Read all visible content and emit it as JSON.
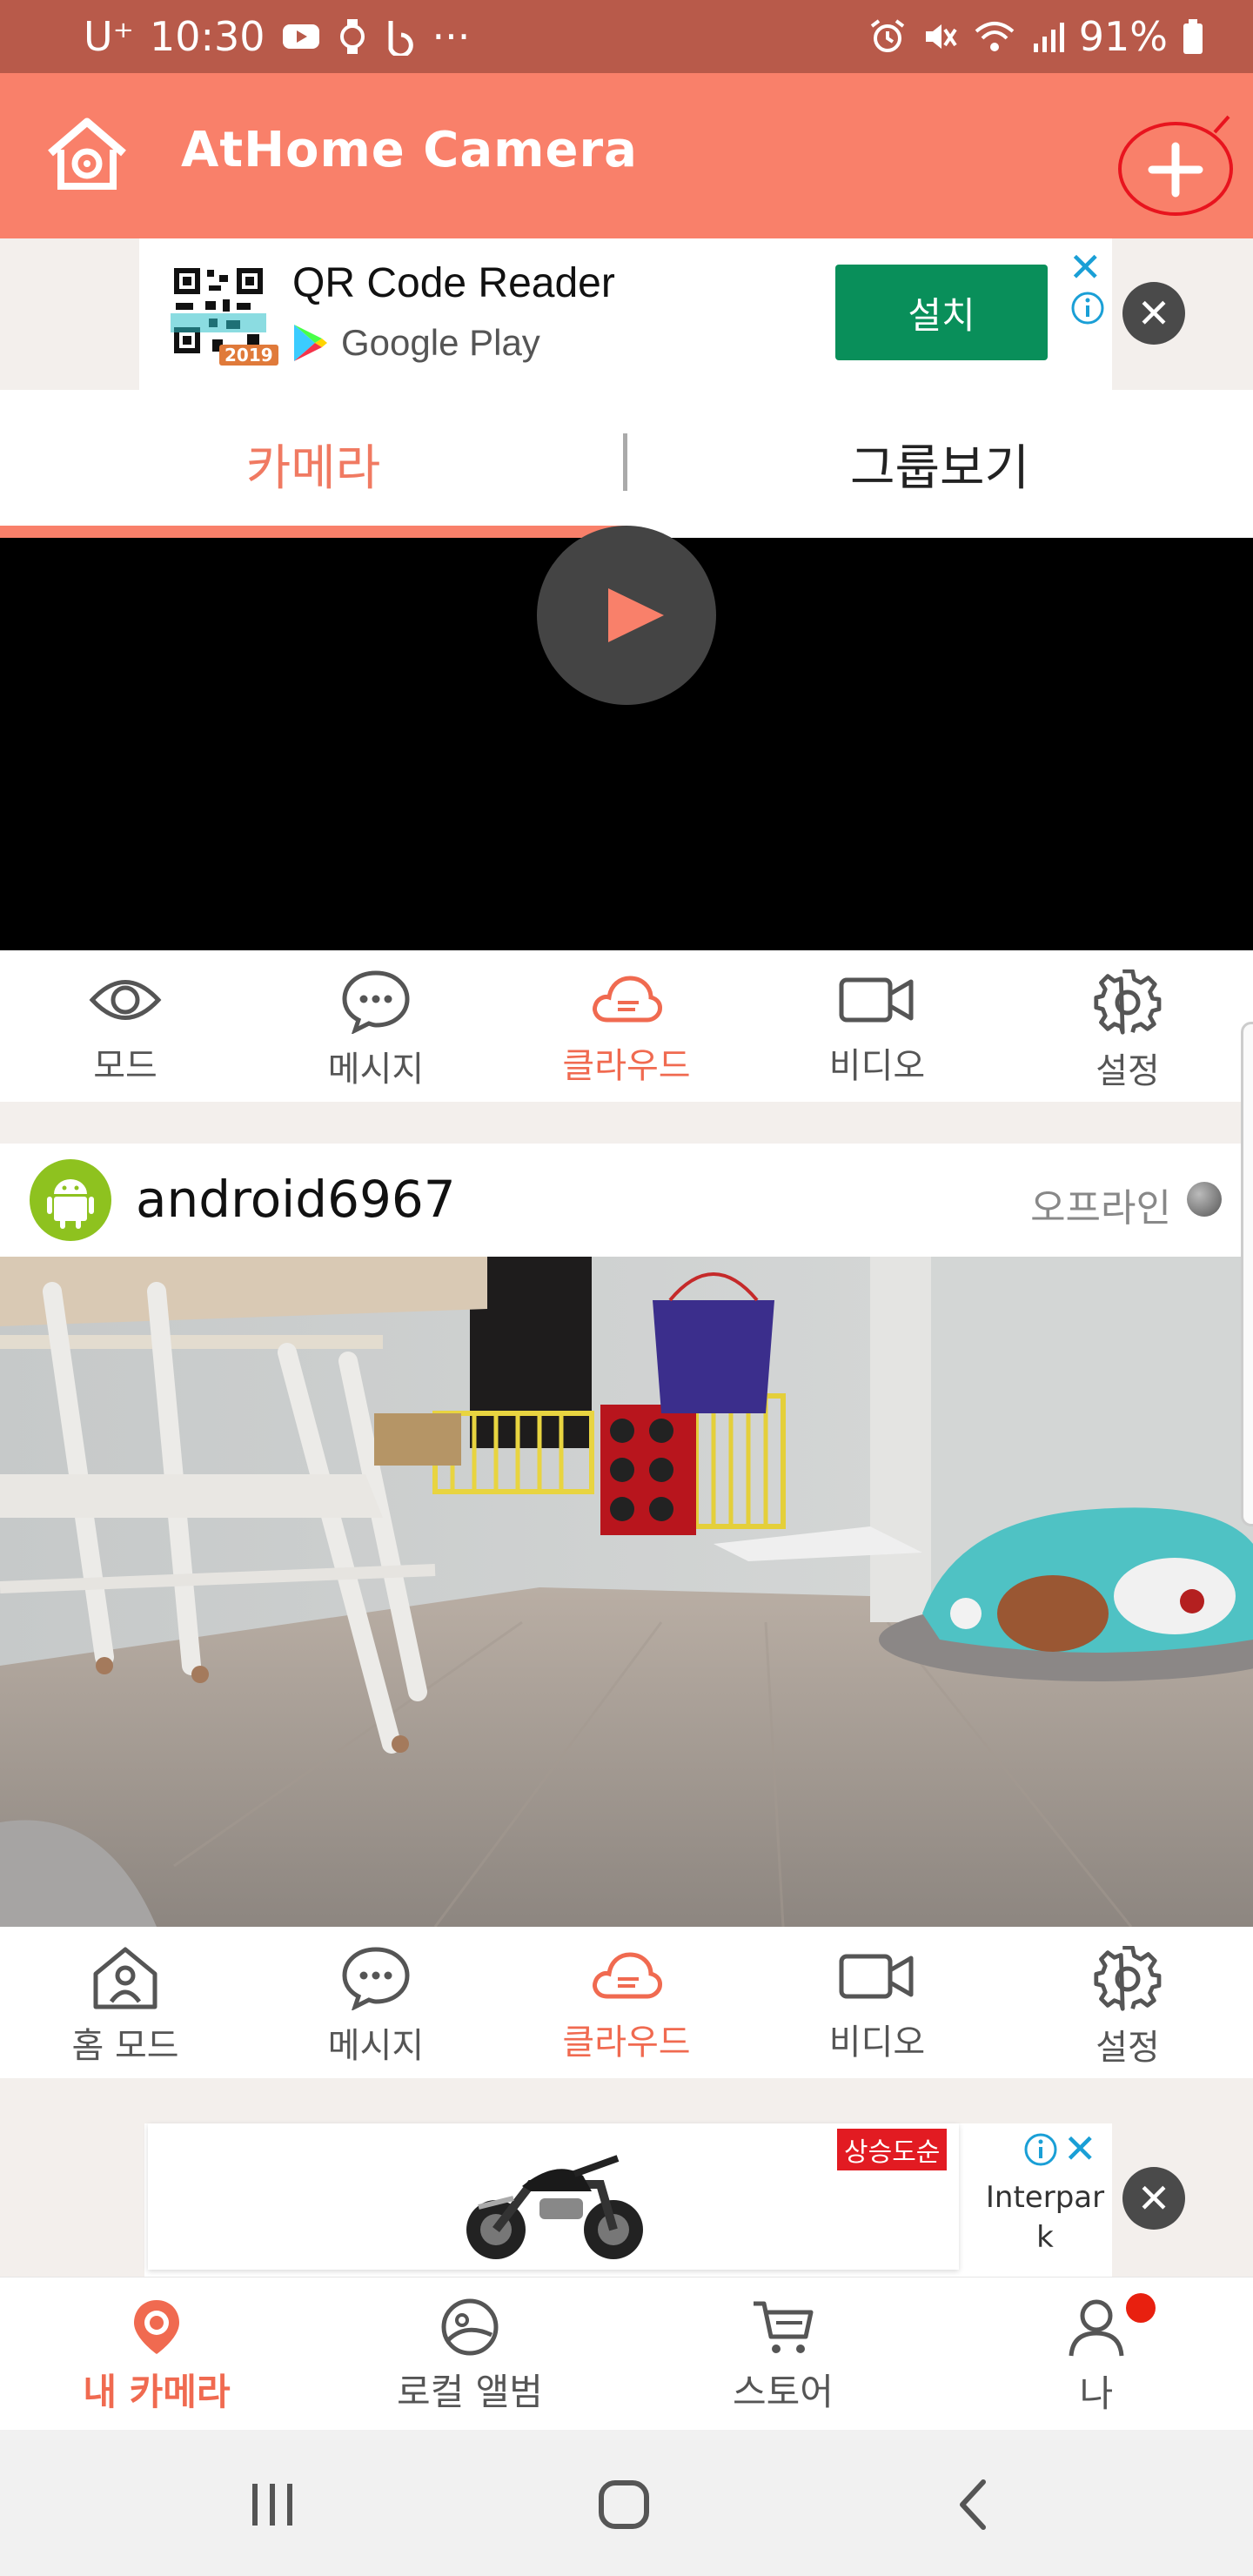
{
  "status_bar": {
    "carrier": "U⁺",
    "time": "10:30",
    "more": "···",
    "battery": "91%"
  },
  "app_bar": {
    "title": "AtHome Camera"
  },
  "top_ad": {
    "qr_badge": "2019",
    "title": "QR Code Reader",
    "store": "Google Play",
    "install_label": "설치"
  },
  "tabs": {
    "camera": "카메라",
    "group_view": "그룹보기"
  },
  "camera1_actions": [
    {
      "label": "모드",
      "icon": "eye-icon"
    },
    {
      "label": "메시지",
      "icon": "message-icon"
    },
    {
      "label": "클라우드",
      "icon": "cloud-icon"
    },
    {
      "label": "비디오",
      "icon": "video-icon"
    },
    {
      "label": "설정",
      "icon": "gear-icon"
    }
  ],
  "camera2": {
    "name": "android6967",
    "status": "오프라인"
  },
  "camera2_actions": [
    {
      "label": "홈 모드",
      "icon": "home-person-icon"
    },
    {
      "label": "메시지",
      "icon": "message-icon"
    },
    {
      "label": "클라우드",
      "icon": "cloud-icon"
    },
    {
      "label": "비디오",
      "icon": "video-icon"
    },
    {
      "label": "설정",
      "icon": "gear-icon"
    }
  ],
  "bottom_ad": {
    "sale_tag": "상승도순",
    "advertiser": "Interpar k"
  },
  "bottom_nav": [
    {
      "label": "내 카메라",
      "icon": "my-camera-icon",
      "active": true
    },
    {
      "label": "로컬 앨범",
      "icon": "album-icon",
      "active": false
    },
    {
      "label": "스토어",
      "icon": "cart-icon",
      "active": false
    },
    {
      "label": "나",
      "icon": "profile-icon",
      "active": false
    }
  ],
  "colors": {
    "app_bar": "#f9806a",
    "status_bar": "#b85a4a",
    "accent": "#f06a50",
    "install_green": "#098f5a"
  }
}
